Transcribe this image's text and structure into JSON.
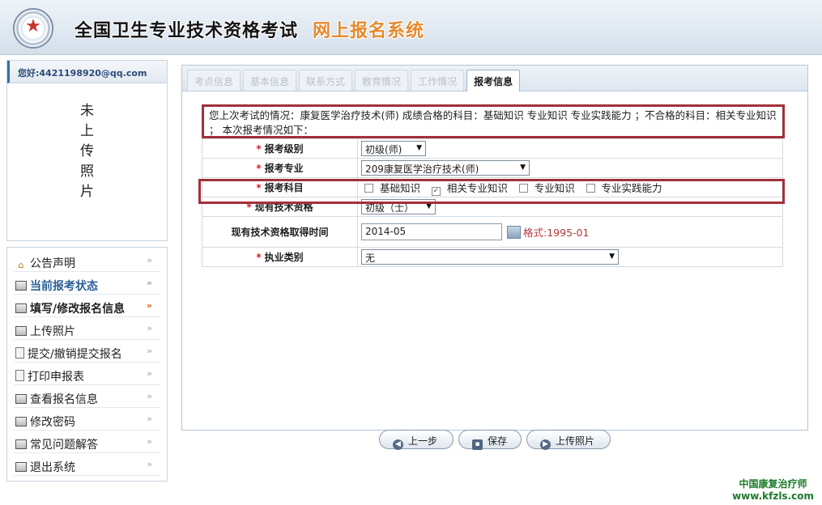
{
  "header": {
    "title_main": "全国卫生专业技术资格考试",
    "title_accent": "网上报名系统"
  },
  "user": {
    "greeting": "您好:4421198920@qq.com",
    "photo_placeholder": [
      "未",
      "上",
      "传",
      "照",
      "片"
    ]
  },
  "menu": [
    {
      "label": "公告声明",
      "icon": "home-icon"
    },
    {
      "label": "当前报考状态",
      "icon": "window-icon"
    },
    {
      "label": "填写/修改报名信息",
      "icon": "window-icon"
    },
    {
      "label": "上传照片",
      "icon": "window-icon"
    },
    {
      "label": "提交/撤销提交报名",
      "icon": "document-icon"
    },
    {
      "label": "打印申报表",
      "icon": "document-icon"
    },
    {
      "label": "查看报名信息",
      "icon": "window-icon"
    },
    {
      "label": "修改密码",
      "icon": "window-icon"
    },
    {
      "label": "常见问题解答",
      "icon": "window-icon"
    },
    {
      "label": "退出系统",
      "icon": "window-icon"
    }
  ],
  "tabs": [
    "考点信息",
    "基本信息",
    "联系方式",
    "教育情况",
    "工作情况",
    "报考信息"
  ],
  "notice": "您上次考试的情况：康复医学治疗技术(师) 成绩合格的科目：基础知识 专业知识 专业实践能力 ；不合格的科目：相关专业知识 ； 本次报考情况如下：",
  "form": {
    "level_label": "报考级别",
    "level_value": "初级(师)",
    "major_label": "报考专业",
    "major_value": "209康复医学治疗技术(师)",
    "subjects_label": "报考科目",
    "subjects": [
      {
        "label": "基础知识",
        "checked": false
      },
      {
        "label": "相关专业知识",
        "checked": true
      },
      {
        "label": "专业知识",
        "checked": false
      },
      {
        "label": "专业实践能力",
        "checked": false
      }
    ],
    "qual_label": "现有技术资格",
    "qual_value": "初级（士）",
    "qual_date_label": "现有技术资格取得时间",
    "qual_date_value": "2014-05",
    "qual_date_format": "格式:1995-01",
    "practice_label": "执业类别",
    "practice_value": "无"
  },
  "buttons": {
    "prev": "上一步",
    "save": "保存",
    "upload": "上传照片"
  },
  "watermark": {
    "line1": "中国康复治疗师",
    "line2": "www.kfzls.com"
  },
  "colors": {
    "highlight_border": "#a3303a",
    "accent_title": "#e6892b",
    "required_star": "#c8202a"
  }
}
